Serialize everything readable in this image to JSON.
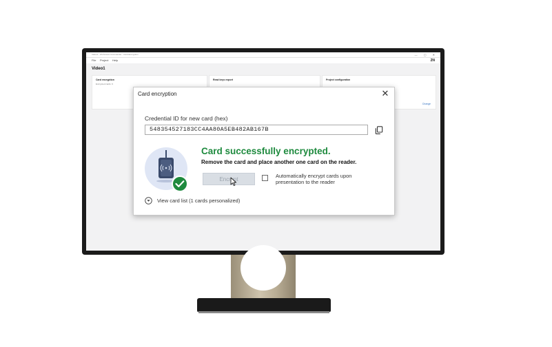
{
  "app": {
    "window_title": "Video1 - 2N Access Commander - Card Encryption",
    "menu": [
      "File",
      "Project",
      "Help"
    ],
    "brand": "2N",
    "title": "Video1",
    "panels": [
      {
        "title": "Card encryption",
        "subtitle": "Encrypted cards: 0"
      },
      {
        "title": "Read keys export",
        "subtitle": ""
      },
      {
        "title": "Project configuration",
        "subtitle": ""
      }
    ],
    "change_link": "Change"
  },
  "dialog": {
    "title": "Card encryption",
    "field_label": "Credential ID for new card (hex)",
    "credential_id": "548354527183CC4AA80A5EB482AB167B",
    "success_title": "Card successfully encrypted.",
    "success_subtitle": "Remove the card and place another one card on the reader.",
    "encrypt_button": "Encrypt",
    "auto_encrypt_label": "Automatically encrypt cards upon presentation to the reader",
    "view_card_list": "View card list (1 cards personalized)",
    "auto_encrypt_checked": false
  },
  "icons": {
    "close": "close-icon",
    "copy": "copy-icon",
    "reader": "card-reader-icon",
    "success": "checkmark-icon",
    "expand": "chevron-down-icon",
    "cursor": "mouse-cursor-icon"
  },
  "colors": {
    "success": "#1e8a3e",
    "reader_bg": "#dfe6f5",
    "reader_device": "#3a4a6b",
    "check_badge": "#1e8a3e",
    "link": "#2f6fc0"
  }
}
